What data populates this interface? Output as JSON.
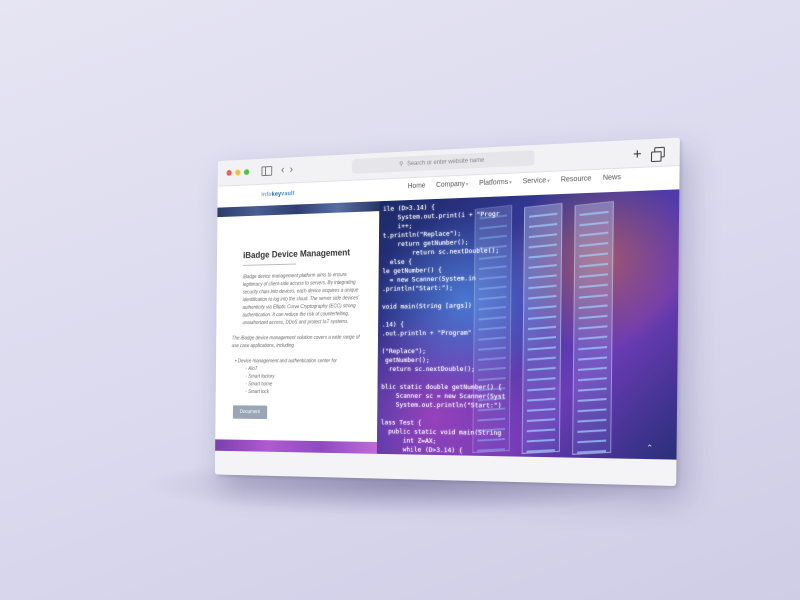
{
  "browser": {
    "url_placeholder": "Search or enter website name",
    "new_tab_label": "+",
    "traffic_colors": [
      "#ef5b55",
      "#f5bd3a",
      "#4fc444"
    ]
  },
  "site": {
    "logo": {
      "part1": "info",
      "part2": "key",
      "part3": "vault"
    },
    "nav": [
      {
        "label": "Home",
        "caret": ""
      },
      {
        "label": "Company",
        "caret": "▾"
      },
      {
        "label": "Platforms",
        "caret": "▾"
      },
      {
        "label": "Service",
        "caret": "▾"
      },
      {
        "label": "Resource",
        "caret": ""
      },
      {
        "label": "News",
        "caret": ""
      }
    ]
  },
  "main": {
    "title": "iBadge Device Management",
    "paragraph1": "iBadge device management platform aims to ensure legitimacy of client-side access to servers. By integrating security chips into devices, each device acquires a unique identification to log into the cloud. The server side devices' authenticity via Elliptic Curve Cryptography (ECC) strong authentication. It can reduce the risk of counterfeiting, unauthorized access, DDoS and protect IoT systems.",
    "paragraph2": "The iBadge device management solution covers a wide range of use case applications, including",
    "feature_heading": "Device management and authentication center for",
    "features": [
      "AIoT",
      "Smart factory",
      "Smart home",
      "Smart lock"
    ],
    "document_button": "Document"
  },
  "hero": {
    "code_lines": [
      "ile (D>3.14) {",
      "    System.out.print(i + \"Progr",
      "    i++;",
      "t.println(\"Replace\");",
      "    return getNumber();",
      "        return sc.nextDouble();",
      "  else {",
      "le getNumber() {",
      "  = new Scanner(System.in",
      ".println(\"Start:\");",
      "",
      "void main(String [args])",
      "",
      ".14) {",
      ".out.println + \"Program\"",
      "",
      "(\"Replace\");",
      " getNumber();",
      "  return sc.nextDouble();",
      "",
      "blic static double getNumber() {",
      "    Scanner sc = new Scanner(Syst",
      "    System.out.println(\"Start:\")",
      "",
      "lass Test {",
      "  public static void main(String",
      "      int Z=AX;",
      "      while (D>3.14) {"
    ],
    "back_to_top": "⌃"
  }
}
